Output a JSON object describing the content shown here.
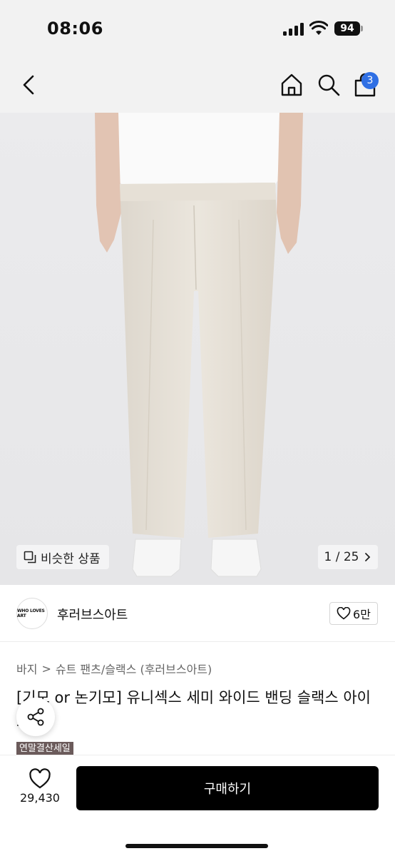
{
  "status_bar": {
    "time": "08:06",
    "battery": "94"
  },
  "nav": {
    "cart_count": "3"
  },
  "product_image": {
    "similar_label": "비슷한 상품",
    "page_indicator": "1 / 25"
  },
  "brand": {
    "logo_text": "WHO LOVES ART",
    "name": "후러브스아트",
    "like_count": "6만"
  },
  "product": {
    "breadcrumb": {
      "category": "바지",
      "separator": ">",
      "subcategory": "슈트 팬츠/슬랙스 (후러브스아트)"
    },
    "title": "[기모 or 논기모] 유니섹스 세미 와이드 밴딩 슬랙스 아이보리",
    "sale_badge": "연말결산세일"
  },
  "bottom_bar": {
    "wish_count": "29,430",
    "buy_label": "구매하기"
  },
  "colors": {
    "accent_badge": "#2f6fe4",
    "sale_badge": "#6b5b5b",
    "buy_button": "#000000"
  }
}
